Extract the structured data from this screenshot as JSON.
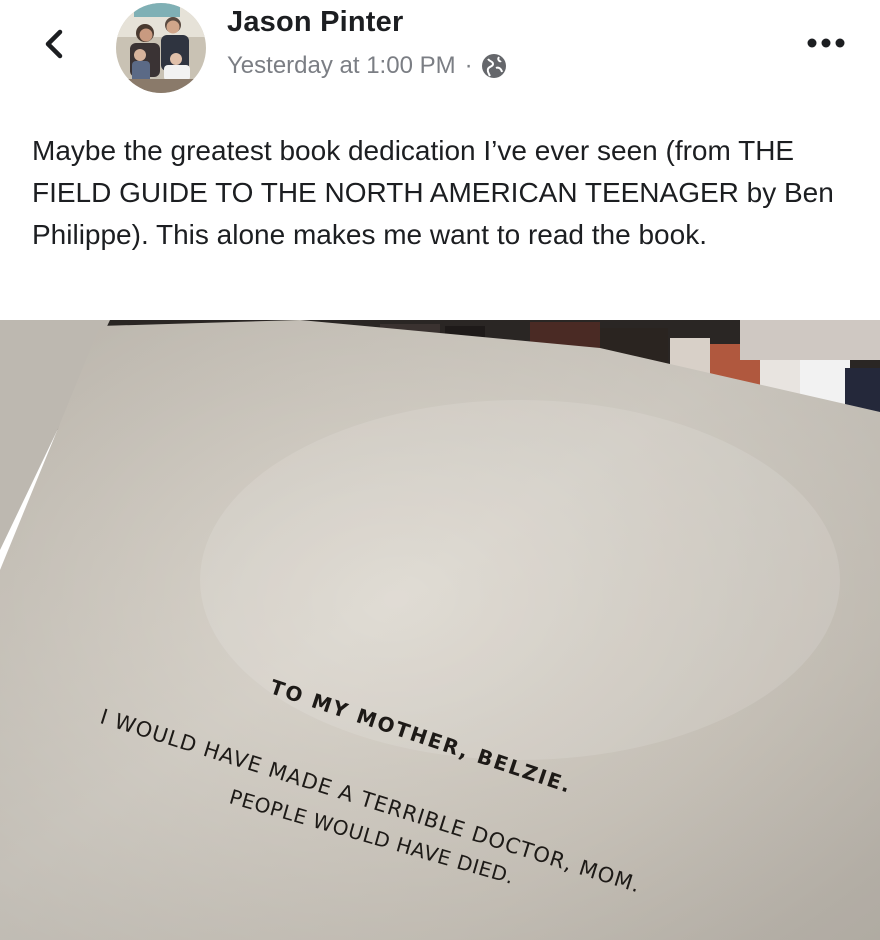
{
  "post": {
    "author": "Jason Pinter",
    "timestamp": "Yesterday at 1:00 PM",
    "separator": "·",
    "audience_icon": "globe-icon",
    "back_icon": "chevron-left-icon",
    "more_icon": "more-horizontal-icon",
    "text": "Maybe the greatest book dedication I’ve ever seen (from THE FIELD GUIDE TO THE NORTH AMERICAN TEENAGER by Ben Philippe). This alone makes me want to read the book."
  },
  "photo": {
    "dedication": {
      "line1": "TO MY MOTHER, BELZIE.",
      "line2": "I WOULD HAVE MADE A TERRIBLE DOCTOR, MOM.",
      "line3": "PEOPLE WOULD HAVE DIED."
    }
  },
  "colors": {
    "text": "#1c1e21",
    "meta": "#7b7e84",
    "page": "#d6d1c8"
  }
}
